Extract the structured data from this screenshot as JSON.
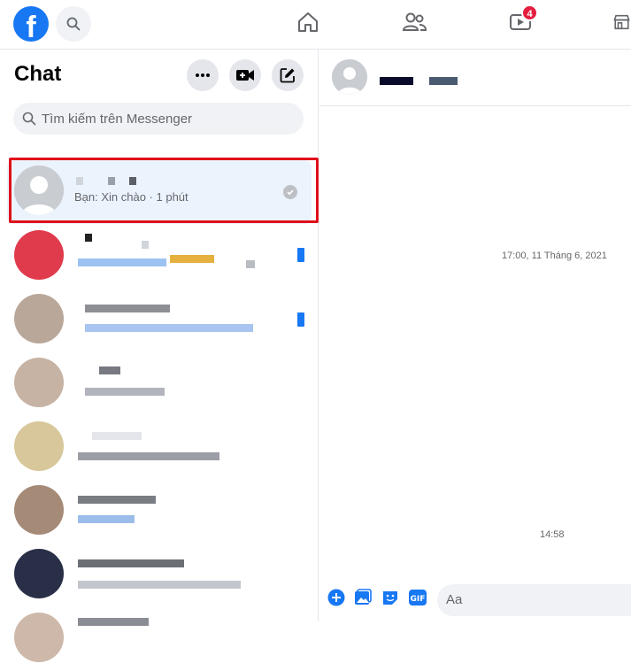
{
  "topbar": {
    "logo_letter": "f",
    "video_badge": "4"
  },
  "sidebar": {
    "title": "Chat",
    "search_placeholder": "Tìm kiếm trên Messenger",
    "active_conversation": {
      "preview": "Bạn: Xin chào · 1 phút"
    },
    "conversations": [
      {
        "avatar_color": "#e03b4c",
        "unread": true
      },
      {
        "avatar_color": "#b9a79a",
        "unread": true
      },
      {
        "avatar_color": "#c7b3a4",
        "unread": false
      },
      {
        "avatar_color": "#d8c79a",
        "unread": false
      },
      {
        "avatar_color": "#a58a77",
        "unread": false
      },
      {
        "avatar_color": "#2a2f48",
        "unread": false
      },
      {
        "avatar_color": "#cdb8a9",
        "unread": false
      }
    ]
  },
  "main": {
    "timestamp_1": "17:00, 11 Tháng 6, 2021",
    "timestamp_2": "14:58",
    "composer_placeholder": "Aa"
  },
  "colors": {
    "accent": "#1877f2",
    "highlight": "#e0101a",
    "badge": "#e41e3f"
  }
}
